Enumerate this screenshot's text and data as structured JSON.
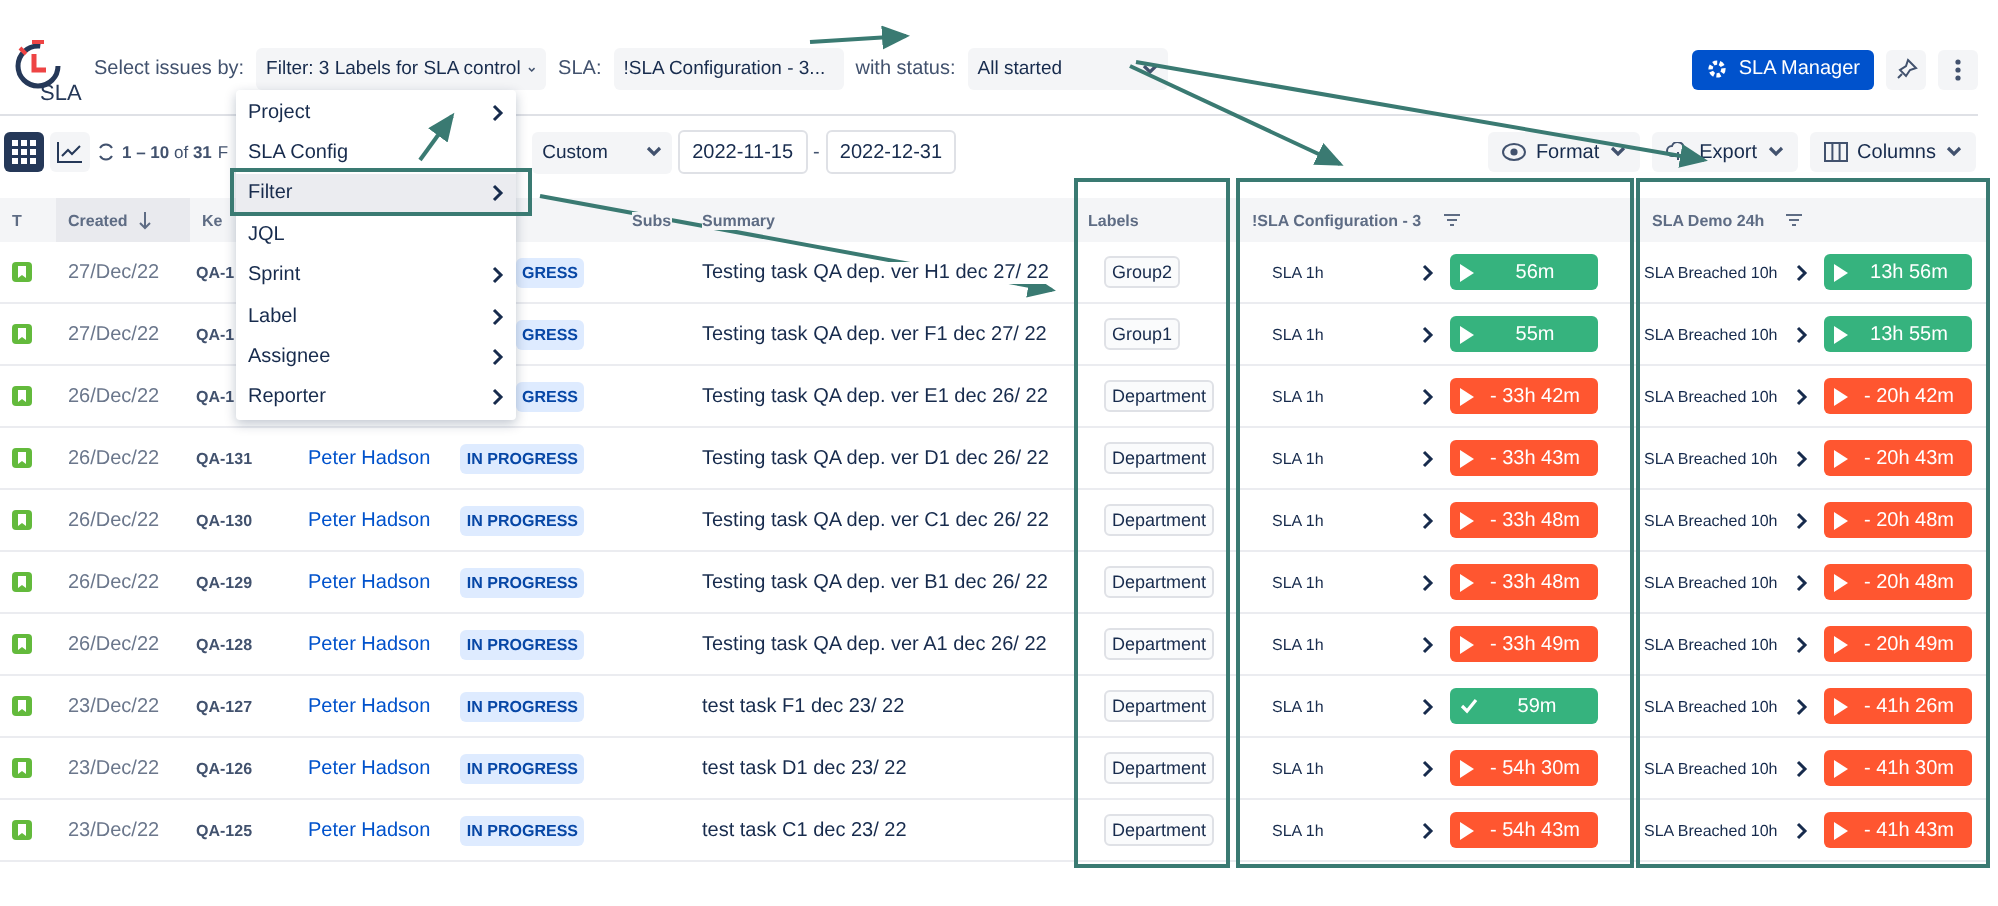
{
  "logo": {
    "text": "SLA"
  },
  "header": {
    "select_label": "Select issues by:",
    "filter": "Filter: 3 Labels for SLA control",
    "sla_label": "SLA:",
    "sla": "!SLA Configuration - 3...",
    "status_label": "with status:",
    "status": "All started",
    "manager_button": "SLA Manager"
  },
  "toolbar": {
    "range": "**1 – 10** of **31**",
    "cut_text": "F",
    "period": "Custom",
    "date_from": "2022-11-15",
    "date_separator": "-",
    "date_to": "2022-12-31",
    "buttons": [
      "Format",
      "Export",
      "Columns"
    ]
  },
  "menu": {
    "items": [
      {
        "label": "Project",
        "submenu": true,
        "selected": false
      },
      {
        "label": "SLA Config",
        "submenu": false,
        "selected": false
      },
      {
        "label": "Filter",
        "submenu": true,
        "selected": true
      },
      {
        "label": "JQL",
        "submenu": false,
        "selected": false
      },
      {
        "label": "Sprint",
        "submenu": true,
        "selected": false
      },
      {
        "label": "Label",
        "submenu": true,
        "selected": false
      },
      {
        "label": "Assignee",
        "submenu": true,
        "selected": false
      },
      {
        "label": "Reporter",
        "submenu": true,
        "selected": false
      }
    ]
  },
  "table": {
    "columns": [
      {
        "label": "T",
        "kind": "plain",
        "sorted": false
      },
      {
        "label": "Created",
        "kind": "plain",
        "sorted": true
      },
      {
        "label": "Ke",
        "kind": "plain",
        "sorted": false
      },
      {
        "label": "Subs",
        "kind": "plain",
        "sorted": false
      },
      {
        "label": "Summary",
        "kind": "plain",
        "sorted": false
      },
      {
        "label": "Labels",
        "kind": "plain",
        "sorted": false
      },
      {
        "label": "!SLA Configuration - 3",
        "kind": "sla",
        "sorted": false
      },
      {
        "label": "SLA Demo 24h",
        "kind": "sla",
        "sorted": false
      }
    ],
    "rows": [
      {
        "created": "27/Dec/22",
        "key": "QA-1",
        "status": "GRESS",
        "summary": "Testing task QA dep. ver H1 dec 27/ 22",
        "label": "Group2",
        "sla": [
          {
            "name": "SLA 1h",
            "time": "56m",
            "kind": "play",
            "breached": false
          },
          {
            "name": "SLA Breached 10h",
            "time": "13h 56m",
            "kind": "play",
            "breached": false
          }
        ]
      },
      {
        "created": "27/Dec/22",
        "key": "QA-1",
        "status": "GRESS",
        "summary": "Testing task QA dep. ver F1 dec 27/ 22",
        "label": "Group1",
        "sla": [
          {
            "name": "SLA 1h",
            "time": "55m",
            "kind": "play",
            "breached": false
          },
          {
            "name": "SLA Breached 10h",
            "time": "13h 55m",
            "kind": "play",
            "breached": false
          }
        ]
      },
      {
        "created": "26/Dec/22",
        "key": "QA-1",
        "status": "GRESS",
        "summary": "Testing task QA dep. ver E1 dec 26/ 22",
        "label": "Department",
        "sla": [
          {
            "name": "SLA 1h",
            "time": "- 33h 42m",
            "kind": "play",
            "breached": true
          },
          {
            "name": "SLA Breached 10h",
            "time": "- 20h 42m",
            "kind": "play",
            "breached": true
          }
        ]
      },
      {
        "created": "26/Dec/22",
        "key": "QA-131",
        "assignee": "Peter Hadson",
        "status": "IN PROGRESS",
        "summary": "Testing task QA dep. ver D1 dec 26/ 22",
        "label": "Department",
        "sla": [
          {
            "name": "SLA 1h",
            "time": "- 33h 43m",
            "kind": "play",
            "breached": true
          },
          {
            "name": "SLA Breached 10h",
            "time": "- 20h 43m",
            "kind": "play",
            "breached": true
          }
        ]
      },
      {
        "created": "26/Dec/22",
        "key": "QA-130",
        "assignee": "Peter Hadson",
        "status": "IN PROGRESS",
        "summary": "Testing task QA dep. ver C1 dec 26/ 22",
        "label": "Department",
        "sla": [
          {
            "name": "SLA 1h",
            "time": "- 33h 48m",
            "kind": "play",
            "breached": true
          },
          {
            "name": "SLA Breached 10h",
            "time": "- 20h 48m",
            "kind": "play",
            "breached": true
          }
        ]
      },
      {
        "created": "26/Dec/22",
        "key": "QA-129",
        "assignee": "Peter Hadson",
        "status": "IN PROGRESS",
        "summary": "Testing task QA dep. ver B1 dec 26/ 22",
        "label": "Department",
        "sla": [
          {
            "name": "SLA 1h",
            "time": "- 33h 48m",
            "kind": "play",
            "breached": true
          },
          {
            "name": "SLA Breached 10h",
            "time": "- 20h 48m",
            "kind": "play",
            "breached": true
          }
        ]
      },
      {
        "created": "26/Dec/22",
        "key": "QA-128",
        "assignee": "Peter Hadson",
        "status": "IN PROGRESS",
        "summary": "Testing task QA dep. ver A1 dec 26/ 22",
        "label": "Department",
        "sla": [
          {
            "name": "SLA 1h",
            "time": "- 33h 49m",
            "kind": "play",
            "breached": true
          },
          {
            "name": "SLA Breached 10h",
            "time": "- 20h 49m",
            "kind": "play",
            "breached": true
          }
        ]
      },
      {
        "created": "23/Dec/22",
        "key": "QA-127",
        "assignee": "Peter Hadson",
        "status": "IN PROGRESS",
        "summary": "test task F1 dec 23/ 22",
        "label": "Department",
        "sla": [
          {
            "name": "SLA 1h",
            "time": "59m",
            "kind": "check",
            "breached": false
          },
          {
            "name": "SLA Breached 10h",
            "time": "- 41h 26m",
            "kind": "play",
            "breached": true
          }
        ]
      },
      {
        "created": "23/Dec/22",
        "key": "QA-126",
        "assignee": "Peter Hadson",
        "status": "IN PROGRESS",
        "summary": "test task D1 dec 23/ 22",
        "label": "Department",
        "sla": [
          {
            "name": "SLA 1h",
            "time": "- 54h 30m",
            "kind": "play",
            "breached": true
          },
          {
            "name": "SLA Breached 10h",
            "time": "- 41h 30m",
            "kind": "play",
            "breached": true
          }
        ]
      },
      {
        "created": "23/Dec/22",
        "key": "QA-125",
        "assignee": "Peter Hadson",
        "status": "IN PROGRESS",
        "summary": "test task C1 dec 23/ 22",
        "label": "Department",
        "sla": [
          {
            "name": "SLA 1h",
            "time": "- 54h 43m",
            "kind": "play",
            "breached": true
          },
          {
            "name": "SLA Breached 10h",
            "time": "- 41h 43m",
            "kind": "play",
            "breached": true
          }
        ]
      }
    ]
  }
}
